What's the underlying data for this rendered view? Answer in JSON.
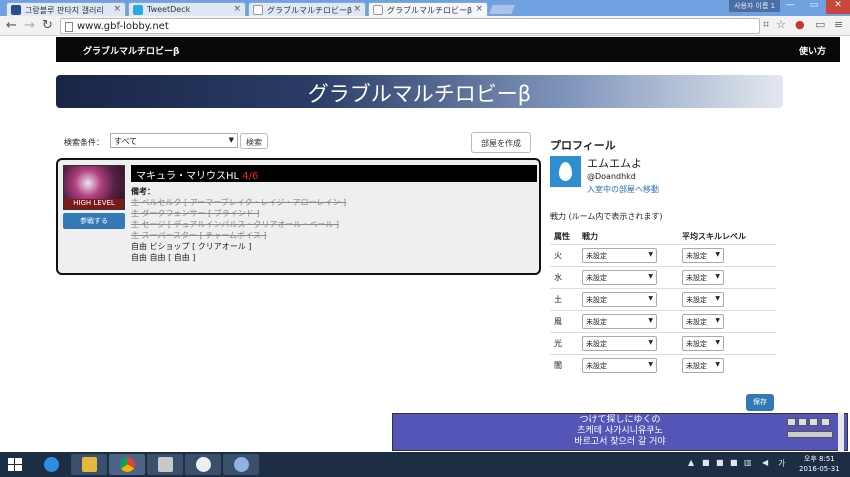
{
  "browser": {
    "tabs": [
      {
        "title": "그랑블루 판타지 갤러리"
      },
      {
        "title": "TweetDeck"
      },
      {
        "title": "グラブルマルチロビーβ"
      },
      {
        "title": "グラブルマルチロビーβ"
      }
    ],
    "user_badge": "사용자 이름 1",
    "url": "www.gbf-lobby.net"
  },
  "site": {
    "brand": "グラブルマルチロビーβ",
    "howto": "使い方",
    "banner_title": "グラブルマルチロビーβ"
  },
  "search": {
    "label": "検索条件：",
    "selected": "すべて",
    "button": "検索",
    "create_button": "部屋を作成"
  },
  "room": {
    "badge": "HIGH LEVEL",
    "join_button": "参戦する",
    "title": "マキュラ・マリウスHL",
    "count": "4/6",
    "notes_label": "備考：",
    "taken": [
      "主 ベルセルク [ アーマーブレイク・レイジ・アローレイン ]",
      "主 ダークフェンサー [ ブラインド ]",
      "主 セージ [ デュアルインパルス・クリアオール・ベール ]",
      "主 スーパースター [ チャームボイス ]"
    ],
    "open": [
      "自由 ビショップ [ クリアオール ]",
      "自由 自由 [ 自由 ]"
    ]
  },
  "profile": {
    "title": "プロフィール",
    "name": "エムエムよ",
    "handle": "@Doandhkd",
    "room_link": "入室中の部屋へ移動",
    "power_note": "戦力 (ルーム内で表示されます)",
    "headers": {
      "attr": "属性",
      "power": "戦力",
      "skill": "平均スキルレベル"
    },
    "rows": [
      {
        "attr": "火",
        "power": "未設定",
        "skill": "未設定"
      },
      {
        "attr": "水",
        "power": "未設定",
        "skill": "未設定"
      },
      {
        "attr": "土",
        "power": "未設定",
        "skill": "未設定"
      },
      {
        "attr": "風",
        "power": "未設定",
        "skill": "未設定"
      },
      {
        "attr": "光",
        "power": "未設定",
        "skill": "未設定"
      },
      {
        "attr": "闇",
        "power": "未設定",
        "skill": "未設定"
      }
    ],
    "save_button": "保存"
  },
  "lyrics": {
    "lines": [
      "つけて探しにゆくの",
      "츠케테 사가시니유쿠노",
      "바르고서 찾으러 갈 거야"
    ]
  },
  "taskbar": {
    "time": "오후 8:51",
    "date": "2016-05-31"
  },
  "icons": [
    "windows-logo-icon",
    "ie-icon",
    "explorer-icon",
    "chrome-icon",
    "photo-app-icon",
    "game-app-icon",
    "paint-app-icon"
  ],
  "colors": {
    "accent": "#3279b6",
    "count_red": "#e8242b",
    "lyrics_bg": "#5555b8"
  }
}
